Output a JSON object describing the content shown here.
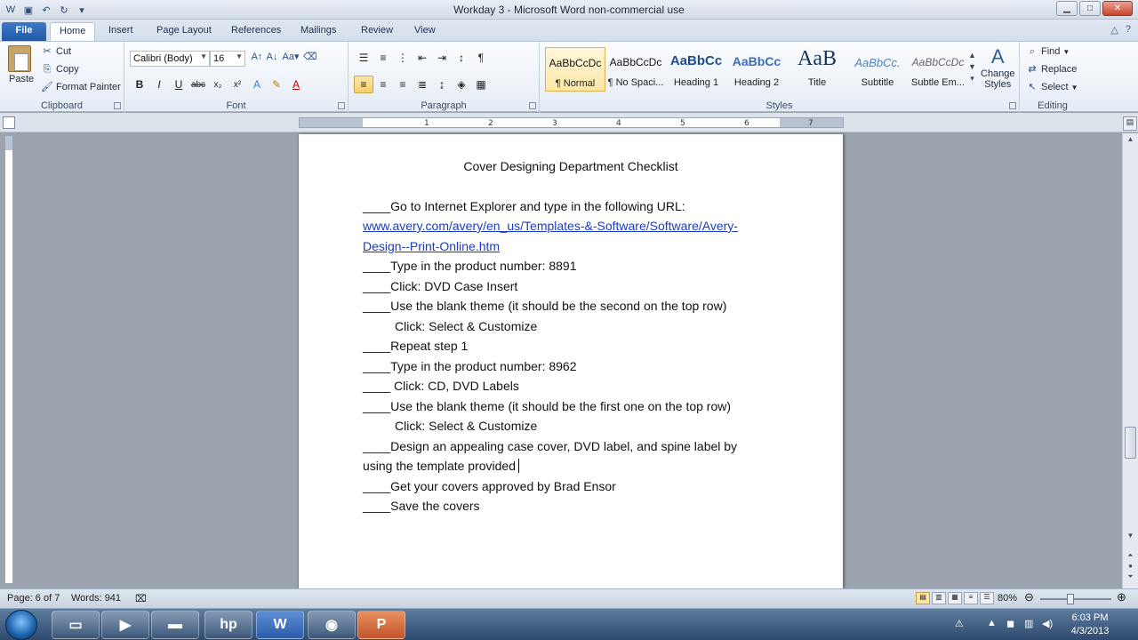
{
  "window": {
    "title": "Workday 3 - Microsoft Word non-commercial use",
    "minimize_icon": "minimize-icon",
    "maximize_icon": "maximize-icon",
    "close_icon": "close-icon"
  },
  "ribbon_tabs": [
    "File",
    "Home",
    "Insert",
    "Page Layout",
    "References",
    "Mailings",
    "Review",
    "View"
  ],
  "clipboard": {
    "group_label": "Clipboard",
    "paste": "Paste",
    "cut": "Cut",
    "copy": "Copy",
    "format_painter": "Format Painter"
  },
  "font": {
    "group_label": "Font",
    "font_name": "Calibri (Body)",
    "font_size": "16"
  },
  "paragraph": {
    "group_label": "Paragraph"
  },
  "styles": {
    "group_label": "Styles",
    "items": [
      {
        "sample": "AaBbCcDc",
        "name": "¶ Normal"
      },
      {
        "sample": "AaBbCcDc",
        "name": "¶ No Spaci..."
      },
      {
        "sample": "AaBbCc",
        "name": "Heading 1"
      },
      {
        "sample": "AaBbCc",
        "name": "Heading 2"
      },
      {
        "sample": "AaB",
        "name": "Title"
      },
      {
        "sample": "AaBbCc.",
        "name": "Subtitle"
      },
      {
        "sample": "AaBbCcDc",
        "name": "Subtle Em..."
      }
    ],
    "change_styles": "Change",
    "change_styles_2": "Styles"
  },
  "editing": {
    "group_label": "Editing",
    "find": "Find",
    "replace": "Replace",
    "select": "Select"
  },
  "ruler_ticks": [
    "1",
    "2",
    "3",
    "4",
    "5",
    "6",
    "7"
  ],
  "document": {
    "title": "Cover Designing Department Checklist",
    "lines": [
      "____Go to Internet Explorer and type in the following URL:",
      "www.avery.com/avery/en_us/Templates-&-Software/Software/Avery-",
      "Design--Print-Online.htm",
      "____Type in the product number: 8891",
      "____Click: DVD Case Insert",
      "____Use the blank theme (it should be the second on the top row)",
      "Click: Select & Customize",
      "____Repeat step 1",
      "____Type in the product number: 8962",
      "____ Click: CD, DVD Labels",
      "____Use the blank theme (it should be the first one on the top row)",
      "Click: Select & Customize",
      "____Design an appealing case cover, DVD label, and spine label by",
      "using the template provided",
      "____Get your covers approved by Brad Ensor",
      "____Save the covers"
    ]
  },
  "status": {
    "page": "Page: 6 of 7",
    "words": "Words: 941",
    "zoom": "80%"
  },
  "clock": {
    "time": "6:03 PM",
    "date": "4/3/2013"
  },
  "colors": {
    "file_tab": "#2a64b2",
    "link": "#1a3cc0",
    "selected_style": "#fde7a5"
  }
}
